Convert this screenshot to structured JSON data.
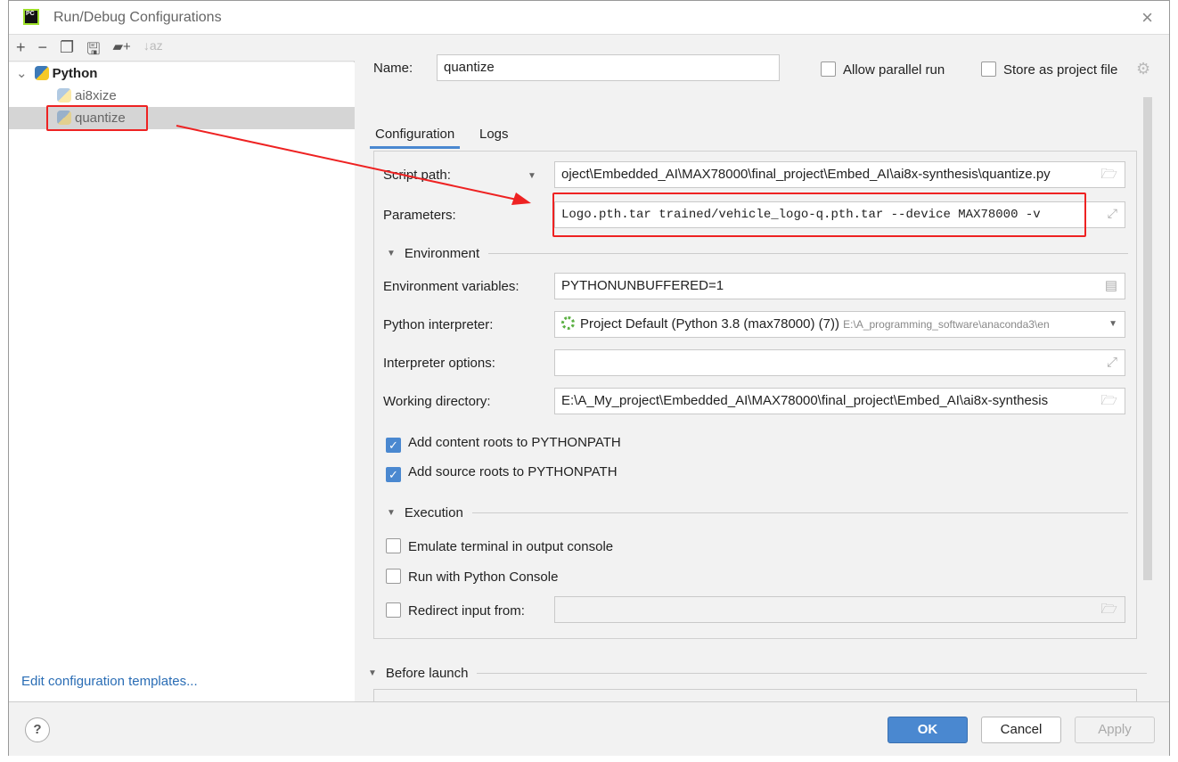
{
  "window": {
    "title": "Run/Debug Configurations",
    "logo": "PC"
  },
  "toolbar": {
    "icons": [
      "plus-icon",
      "minus-icon",
      "copy-icon",
      "save-icon",
      "new-folder-icon",
      "sort-icon"
    ]
  },
  "tree": {
    "root": "Python",
    "items": [
      {
        "label": "ai8xize"
      },
      {
        "label": "quantize",
        "selected": true
      }
    ]
  },
  "edit_templates": "Edit configuration templates...",
  "name": {
    "label": "Name:",
    "value": "quantize"
  },
  "allow_parallel": {
    "label": "Allow parallel run",
    "checked": false
  },
  "store_project": {
    "label": "Store as project file",
    "checked": false
  },
  "tabs": [
    "Configuration",
    "Logs"
  ],
  "script_path": {
    "label": "Script path:",
    "value": "oject\\Embedded_AI\\MAX78000\\final_project\\Embed_AI\\ai8x-synthesis\\quantize.py"
  },
  "parameters": {
    "label": "Parameters:",
    "value": "Logo.pth.tar trained/vehicle_logo-q.pth.tar --device MAX78000 -v"
  },
  "environment": {
    "title": "Environment",
    "env_vars": {
      "label": "Environment variables:",
      "value": "PYTHONUNBUFFERED=1"
    },
    "interpreter": {
      "label": "Python interpreter:",
      "value": "Project Default (Python 3.8 (max78000) (7))",
      "path": "E:\\A_programming_software\\anaconda3\\en"
    },
    "interp_options": {
      "label": "Interpreter options:",
      "value": ""
    },
    "working_dir": {
      "label": "Working directory:",
      "value": "E:\\A_My_project\\Embedded_AI\\MAX78000\\final_project\\Embed_AI\\ai8x-synthesis"
    },
    "content_roots": {
      "label": "Add content roots to PYTHONPATH",
      "checked": true
    },
    "source_roots": {
      "label": "Add source roots to PYTHONPATH",
      "checked": true
    }
  },
  "execution": {
    "title": "Execution",
    "emulate": {
      "label": "Emulate terminal in output console",
      "checked": false
    },
    "console": {
      "label": "Run with Python Console",
      "checked": false
    },
    "redirect": {
      "label": "Redirect input from:",
      "checked": false,
      "value": ""
    }
  },
  "before_launch": {
    "title": "Before launch"
  },
  "buttons": {
    "ok": "OK",
    "cancel": "Cancel",
    "apply": "Apply",
    "help": "?"
  },
  "colors": {
    "accent": "#4a88d0",
    "annotation": "#e22222"
  }
}
